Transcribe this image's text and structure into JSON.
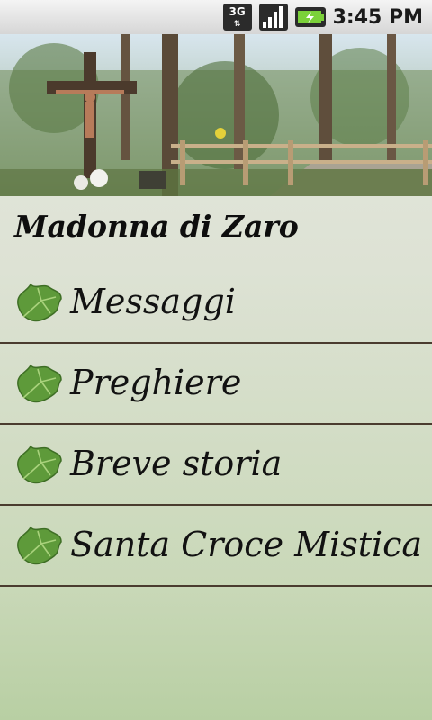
{
  "status_bar": {
    "network": "3G",
    "time": "3:45 PM",
    "icons": [
      "3g-data-icon",
      "signal-strength-icon",
      "battery-charging-icon"
    ]
  },
  "header": {
    "image": "crucifix-in-forest-photo",
    "title": "Madonna di Zaro"
  },
  "menu": {
    "items": [
      {
        "label": "Messaggi",
        "icon": "ivy-leaf-icon"
      },
      {
        "label": "Preghiere",
        "icon": "ivy-leaf-icon"
      },
      {
        "label": "Breve storia",
        "icon": "ivy-leaf-icon"
      },
      {
        "label": "Santa Croce Mistica",
        "icon": "ivy-leaf-icon"
      }
    ]
  },
  "colors": {
    "divider": "#4a3c2f",
    "leaf": "#5e9a3a"
  }
}
